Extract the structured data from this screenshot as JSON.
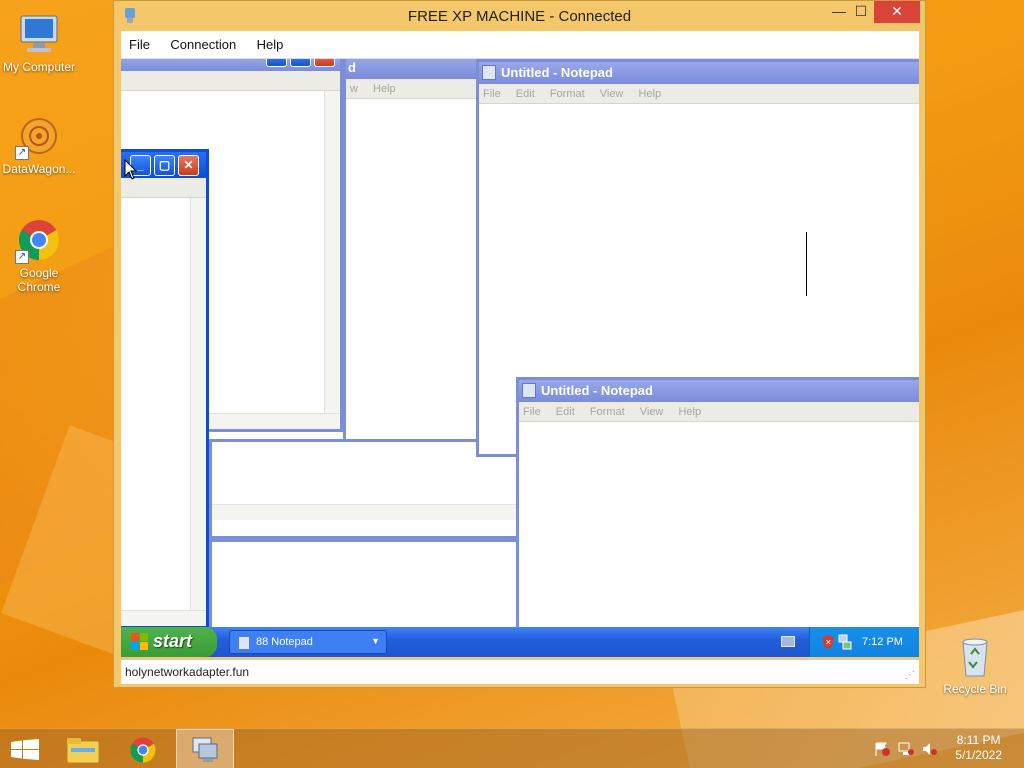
{
  "desktop": {
    "icons": [
      {
        "label": "My Computer",
        "icon": "my-computer-icon"
      },
      {
        "label": "DataWagon...",
        "icon": "datawagon-icon"
      },
      {
        "label": "Google Chrome",
        "icon": "chrome-icon"
      },
      {
        "label": "Recycle Bin",
        "icon": "recycle-bin-icon"
      }
    ]
  },
  "rd_window": {
    "title": "FREE XP MACHINE - Connected",
    "minimize": "—",
    "maximize": "☐",
    "close": "✕",
    "menu": [
      "File",
      "Connection",
      "Help"
    ],
    "status": "holynetworkadapter.fun"
  },
  "xp": {
    "notepad_title": "Untitled - Notepad",
    "notepad_menu": [
      "File",
      "Edit",
      "Format",
      "View",
      "Help"
    ],
    "partial_menu_help": "Help",
    "partial_menu_w": "w",
    "partial_title_d": "d",
    "start_label": "start",
    "taskbar_button": "88 Notepad",
    "tray_time": "7:12 PM"
  },
  "taskbar": {
    "time": "8:11 PM",
    "date": "5/1/2022",
    "buttons": [
      "start-icon",
      "file-explorer-icon",
      "chrome-icon",
      "remote-desktop-icon"
    ]
  }
}
